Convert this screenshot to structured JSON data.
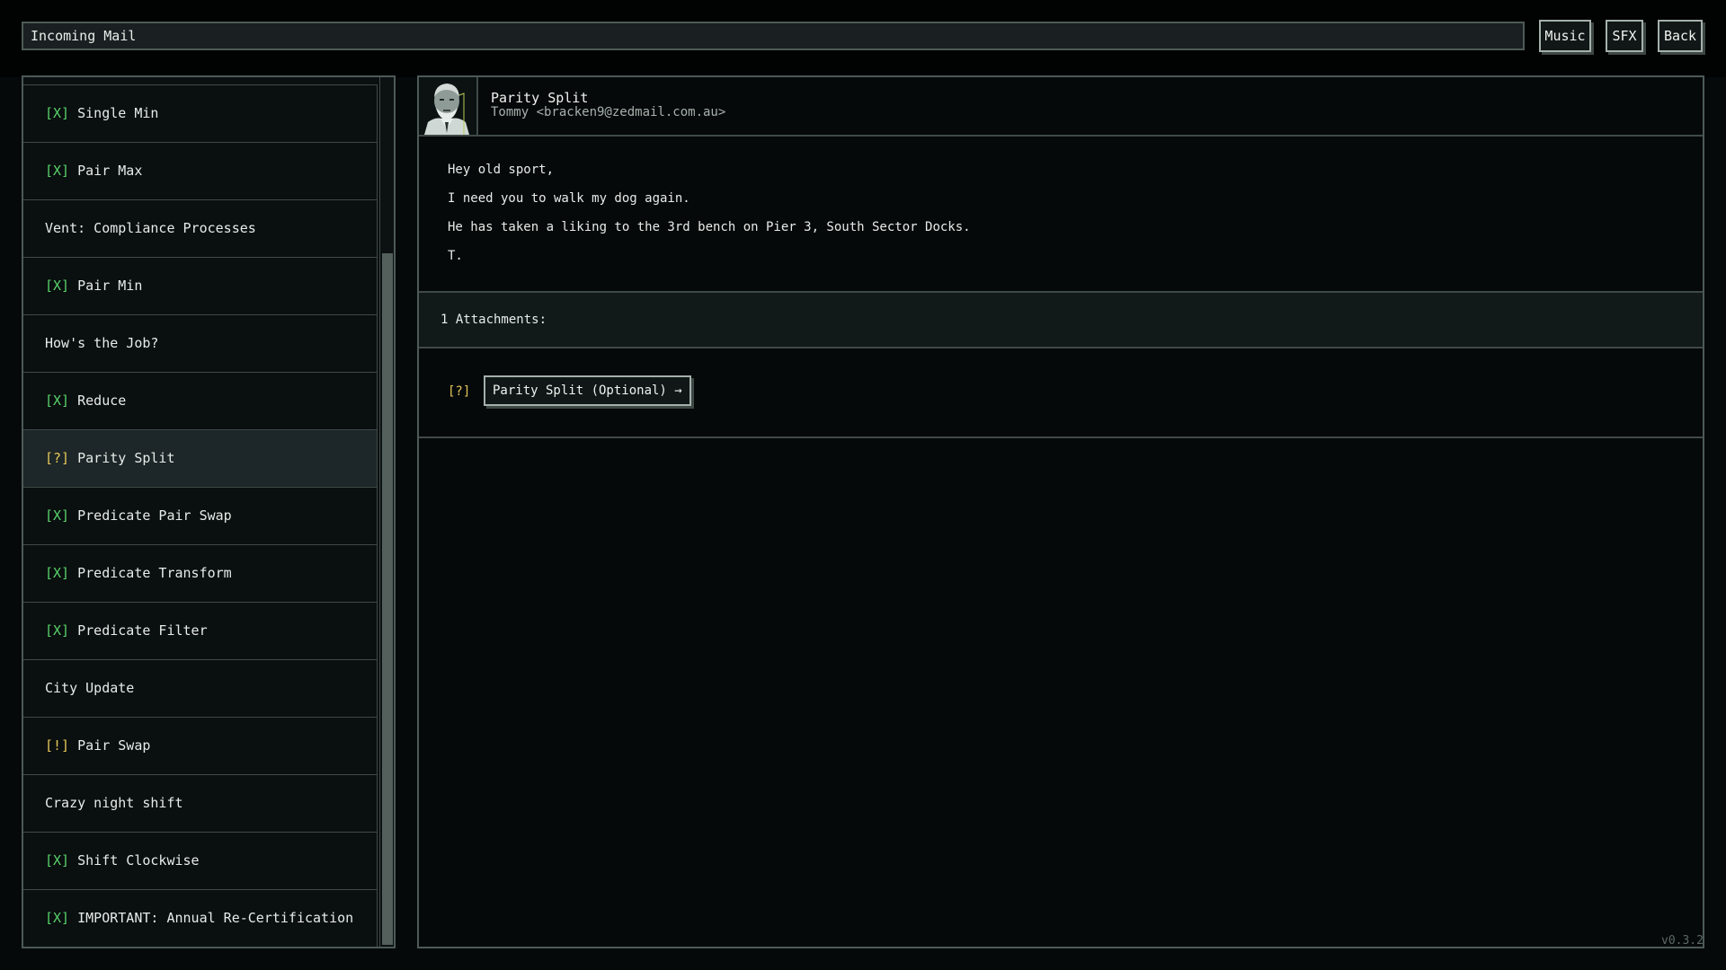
{
  "window": {
    "title": "Incoming Mail"
  },
  "toolbar": {
    "music_label": "Music",
    "sfx_label": "SFX",
    "back_label": "Back"
  },
  "mail_list": {
    "items": [
      {
        "mark": "[X]",
        "status": "done",
        "label": "Single Min"
      },
      {
        "mark": "[X]",
        "status": "done",
        "label": "Pair Max"
      },
      {
        "mark": "",
        "status": "info",
        "label": "Vent: Compliance Processes"
      },
      {
        "mark": "[X]",
        "status": "done",
        "label": "Pair Min"
      },
      {
        "mark": "",
        "status": "info",
        "label": "How's the Job?"
      },
      {
        "mark": "[X]",
        "status": "done",
        "label": "Reduce"
      },
      {
        "mark": "[?]",
        "status": "optional",
        "label": "Parity Split",
        "selected": true
      },
      {
        "mark": "[X]",
        "status": "done",
        "label": "Predicate Pair Swap"
      },
      {
        "mark": "[X]",
        "status": "done",
        "label": "Predicate Transform"
      },
      {
        "mark": "[X]",
        "status": "done",
        "label": "Predicate Filter"
      },
      {
        "mark": "",
        "status": "info",
        "label": "City Update"
      },
      {
        "mark": "[!]",
        "status": "todo",
        "label": "Pair Swap"
      },
      {
        "mark": "",
        "status": "info",
        "label": "Crazy night shift"
      },
      {
        "mark": "[X]",
        "status": "done",
        "label": "Shift Clockwise"
      },
      {
        "mark": "[X]",
        "status": "done",
        "label": "IMPORTANT: Annual Re-Certification"
      }
    ]
  },
  "message": {
    "subject": "Parity Split",
    "sender": "Tommy <bracken9@zedmail.com.au>",
    "avatar_icon": "old-man-portrait",
    "body": [
      "Hey old sport,",
      "I need you to walk my dog again.",
      "He has taken a liking to the 3rd bench on Pier 3, South Sector Docks.",
      "T."
    ],
    "attachments_label": "1 Attachments:",
    "attachment": {
      "mark": "[?]",
      "label": "Parity Split (Optional) →"
    }
  },
  "version": "v0.3.2",
  "colors": {
    "done": "#58d36a",
    "optional": "#e5c85a",
    "todo": "#e5c85a",
    "panel_border": "#4c5a56",
    "selected_row": "#1d2628"
  }
}
